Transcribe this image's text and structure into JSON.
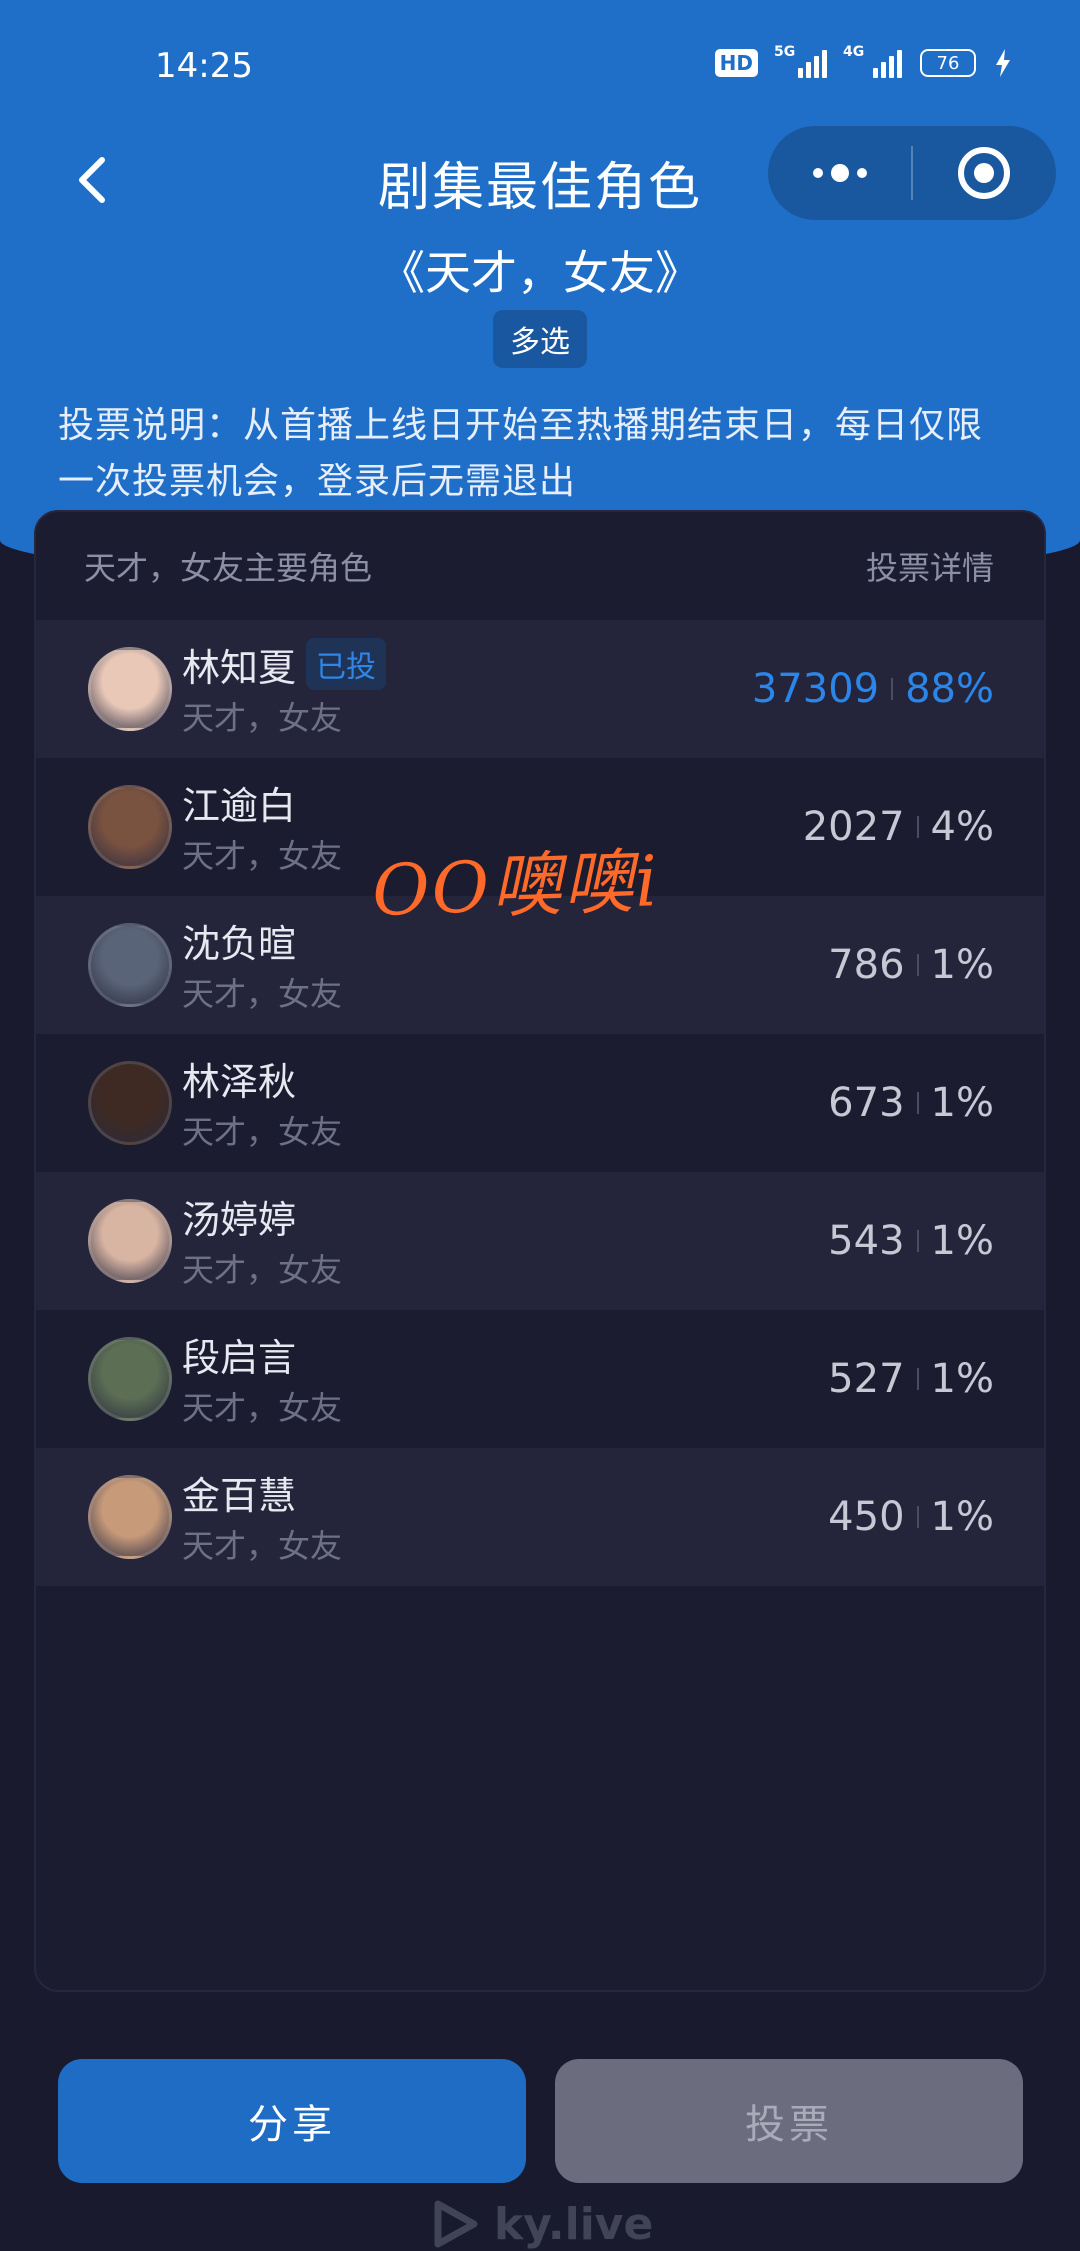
{
  "status_bar": {
    "time": "14:25",
    "hd": "HD",
    "net1": "5G",
    "net2": "4G",
    "battery": "76"
  },
  "nav": {
    "title": "剧集最佳角色",
    "back_icon": "chevron-left-icon",
    "more_icon": "more-dots-icon",
    "close_icon": "target-circle-icon"
  },
  "subtitle": "《天才，女友》",
  "mode_badge": "多选",
  "notice": "投票说明：从首播上线日开始至热播期结束日，每日仅限一次投票机会，登录后无需退出",
  "card": {
    "header_left": "天才，女友主要角色",
    "header_right": "投票详情",
    "rows": [
      {
        "name": "林知夏",
        "show": "天才，女友",
        "votes": "37309",
        "percent": "88%",
        "voted": "已投",
        "avatar_color": "#e9c8b8"
      },
      {
        "name": "江逾白",
        "show": "天才，女友",
        "votes": "2027",
        "percent": "4%",
        "avatar_color": "#7a5240"
      },
      {
        "name": "沈负暄",
        "show": "天才，女友",
        "votes": "786",
        "percent": "1%",
        "avatar_color": "#5a6478"
      },
      {
        "name": "林泽秋",
        "show": "天才，女友",
        "votes": "673",
        "percent": "1%",
        "avatar_color": "#3e2a22"
      },
      {
        "name": "汤婷婷",
        "show": "天才，女友",
        "votes": "543",
        "percent": "1%",
        "avatar_color": "#d8b4a2"
      },
      {
        "name": "段启言",
        "show": "天才，女友",
        "votes": "527",
        "percent": "1%",
        "avatar_color": "#5c6e54"
      },
      {
        "name": "金百慧",
        "show": "天才，女友",
        "votes": "450",
        "percent": "1%",
        "avatar_color": "#c79a7a"
      }
    ]
  },
  "overlay_text": "OO噢噢i",
  "buttons": {
    "share": "分享",
    "vote": "投票"
  },
  "footer_logo": "ky.live",
  "colors": {
    "header_blue": "#1f6fc8",
    "accent_blue": "#2b86ea",
    "background": "#191a2e"
  }
}
